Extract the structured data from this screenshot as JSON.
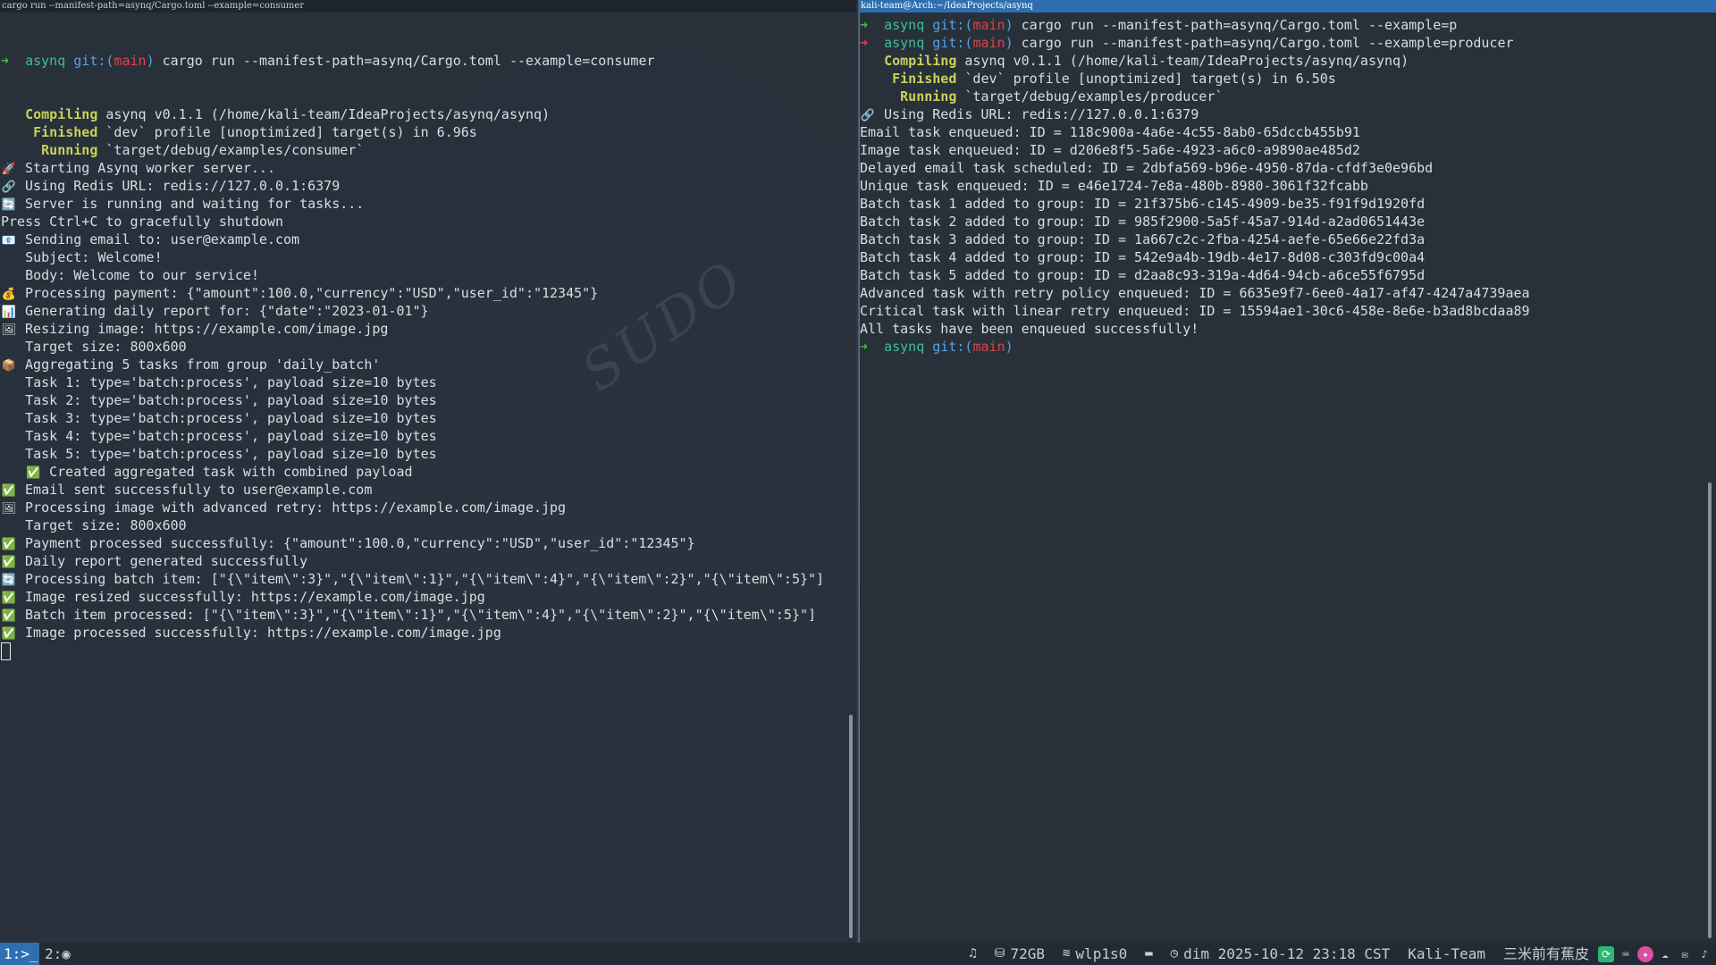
{
  "left_pane": {
    "title": "cargo run --manifest-path=asynq/Cargo.toml --example=consumer",
    "prompt": {
      "dir": "asynq",
      "git": "git:(",
      "branch": "main",
      "close": ")",
      "command": "cargo run --manifest-path=asynq/Cargo.toml --example=consumer"
    },
    "lines": [
      {
        "tag": "Compiling",
        "text": "asynq v0.1.1 (/home/kali-team/IdeaProjects/asynq/asynq)"
      },
      {
        "tag": "Finished",
        "text": "`dev` profile [unoptimized] target(s) in 6.96s"
      },
      {
        "tag": "Running",
        "text": "`target/debug/examples/consumer`"
      },
      {
        "emoji": "🚀",
        "text": "Starting Asynq worker server..."
      },
      {
        "emoji": "🔗",
        "text": "Using Redis URL: redis://127.0.0.1:6379"
      },
      {
        "emoji": "🔄",
        "text": "Server is running and waiting for tasks..."
      },
      {
        "text": "Press Ctrl+C to gracefully shutdown"
      },
      {
        "emoji": "📧",
        "text": "Sending email to: user@example.com"
      },
      {
        "text": "   Subject: Welcome!"
      },
      {
        "text": "   Body: Welcome to our service!"
      },
      {
        "emoji": "💰",
        "text": "Processing payment: {\"amount\":100.0,\"currency\":\"USD\",\"user_id\":\"12345\"}"
      },
      {
        "emoji": "📊",
        "text": "Generating daily report for: {\"date\":\"2023-01-01\"}"
      },
      {
        "emoji": "🖼",
        "text": "Resizing image: https://example.com/image.jpg"
      },
      {
        "text": "   Target size: 800x600"
      },
      {
        "emoji": "📦",
        "text": "Aggregating 5 tasks from group 'daily_batch'"
      },
      {
        "text": "   Task 1: type='batch:process', payload size=10 bytes"
      },
      {
        "text": "   Task 2: type='batch:process', payload size=10 bytes"
      },
      {
        "text": "   Task 3: type='batch:process', payload size=10 bytes"
      },
      {
        "text": "   Task 4: type='batch:process', payload size=10 bytes"
      },
      {
        "text": "   Task 5: type='batch:process', payload size=10 bytes"
      },
      {
        "indent": true,
        "emoji": "✅",
        "text": "Created aggregated task with combined payload"
      },
      {
        "emoji": "✅",
        "text": "Email sent successfully to user@example.com"
      },
      {
        "emoji": "🖼",
        "text": "Processing image with advanced retry: https://example.com/image.jpg"
      },
      {
        "text": "   Target size: 800x600"
      },
      {
        "emoji": "✅",
        "text": "Payment processed successfully: {\"amount\":100.0,\"currency\":\"USD\",\"user_id\":\"12345\"}"
      },
      {
        "emoji": "✅",
        "text": "Daily report generated successfully"
      },
      {
        "emoji": "🔄",
        "text": "Processing batch item: [\"{\\\"item\\\":3}\",\"{\\\"item\\\":1}\",\"{\\\"item\\\":4}\",\"{\\\"item\\\":2}\",\"{\\\"item\\\":5}\"]"
      },
      {
        "emoji": "✅",
        "text": "Image resized successfully: https://example.com/image.jpg"
      },
      {
        "emoji": "✅",
        "text": "Batch item processed: [\"{\\\"item\\\":3}\",\"{\\\"item\\\":1}\",\"{\\\"item\\\":4}\",\"{\\\"item\\\":2}\",\"{\\\"item\\\":5}\"]"
      },
      {
        "emoji": "✅",
        "text": "Image processed successfully: https://example.com/image.jpg"
      }
    ]
  },
  "right_pane": {
    "title": "kali-team@Arch:~/IdeaProjects/asynq",
    "prompt_lines": [
      {
        "error": false,
        "dir": "asynq",
        "git": "git:(",
        "branch": "main",
        "close": ")",
        "command": "cargo run --manifest-path=asynq/Cargo.toml --example=p"
      },
      {
        "error": true,
        "dir": "asynq",
        "git": "git:(",
        "branch": "main",
        "close": ")",
        "command": "cargo run --manifest-path=asynq/Cargo.toml --example=producer"
      }
    ],
    "lines": [
      {
        "tag": "Compiling",
        "text": "asynq v0.1.1 (/home/kali-team/IdeaProjects/asynq/asynq)"
      },
      {
        "tag": "Finished",
        "text": "`dev` profile [unoptimized] target(s) in 6.50s"
      },
      {
        "tag": "Running",
        "text": "`target/debug/examples/producer`"
      },
      {
        "emoji": "🔗",
        "text": "Using Redis URL: redis://127.0.0.1:6379"
      },
      {
        "text": "Email task enqueued: ID = 118c900a-4a6e-4c55-8ab0-65dccb455b91"
      },
      {
        "text": "Image task enqueued: ID = d206e8f5-5a6e-4923-a6c0-a9890ae485d2"
      },
      {
        "text": "Delayed email task scheduled: ID = 2dbfa569-b96e-4950-87da-cfdf3e0e96bd"
      },
      {
        "text": "Unique task enqueued: ID = e46e1724-7e8a-480b-8980-3061f32fcabb"
      },
      {
        "text": "Batch task 1 added to group: ID = 21f375b6-c145-4909-be35-f91f9d1920fd"
      },
      {
        "text": "Batch task 2 added to group: ID = 985f2900-5a5f-45a7-914d-a2ad0651443e"
      },
      {
        "text": "Batch task 3 added to group: ID = 1a667c2c-2fba-4254-aefe-65e66e22fd3a"
      },
      {
        "text": "Batch task 4 added to group: ID = 542e9a4b-19db-4e17-8d08-c303fd9c00a4"
      },
      {
        "text": "Batch task 5 added to group: ID = d2aa8c93-319a-4d64-94cb-a6ce55f6795d"
      },
      {
        "text": "Advanced task with retry policy enqueued: ID = 6635e9f7-6ee0-4a17-af47-4247a4739aea"
      },
      {
        "text": "Critical task with linear retry enqueued: ID = 15594ae1-30c6-458e-8e6e-b3ad8bcdaa89"
      },
      {
        "text": "All tasks have been enqueued successfully!"
      }
    ],
    "final_prompt": {
      "dir": "asynq",
      "git": "git:(",
      "branch": "main",
      "close": ")"
    }
  },
  "statusbar": {
    "workspace_1": "1:>_",
    "workspace_2": "2:",
    "disk": "72GB",
    "network": "wlp1s0",
    "datetime": "dim 2025-10-12 23:18 CST",
    "user": "Kali-Team",
    "chinese_text": "三米前有蕉皮"
  },
  "icons": {
    "prompt": "prompt-arrow-icon",
    "music": "music-note-icon",
    "disk": "disk-icon",
    "wifi": "wifi-icon",
    "battery": "battery-icon",
    "clock": "clock-icon"
  },
  "colors": {
    "focused_title": "#2f6fb0",
    "prompt_ok": "#3fbf3f",
    "prompt_err": "#e04545",
    "cargo_tag": "#c8d05a"
  }
}
